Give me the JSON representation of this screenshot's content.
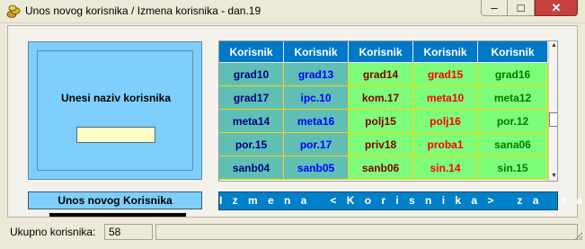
{
  "window": {
    "title": "Unos novog korisnika / Izmena korisnika - dan.19",
    "minimize_glyph": "–",
    "maximize_glyph": "□",
    "close_glyph": "✕"
  },
  "form": {
    "prompt": "Unesi naziv korisnika",
    "name_value": "",
    "new_button": "Unos novog Korisnika",
    "edit_button": "I z m e n a   < K o r i s n i k a >   z a   r a d"
  },
  "grid": {
    "headers": [
      "Korisnik",
      "Korisnik",
      "Korisnik",
      "Korisnik",
      "Korisnik"
    ],
    "rows": [
      [
        "grad10",
        "grad13",
        "grad14",
        "grad15",
        "grad16"
      ],
      [
        "grad17",
        "ipc.10",
        "kom.17",
        "meta10",
        "meta12"
      ],
      [
        "meta14",
        "meta16",
        "polj15",
        "polj16",
        "por.12"
      ],
      [
        "por.15",
        "por.17",
        "priv18",
        "proba1",
        "sana06"
      ],
      [
        "sanb04",
        "sanb05",
        "sanb06",
        "sin.14",
        "sin.15"
      ]
    ],
    "colors": {
      "col1": "#5fbfb5",
      "col2": "#7dfd7a",
      "header": "#0078c8",
      "grid_line": "#ffd400"
    }
  },
  "status": {
    "label": "Ukupno korisnika:",
    "count": "58"
  }
}
